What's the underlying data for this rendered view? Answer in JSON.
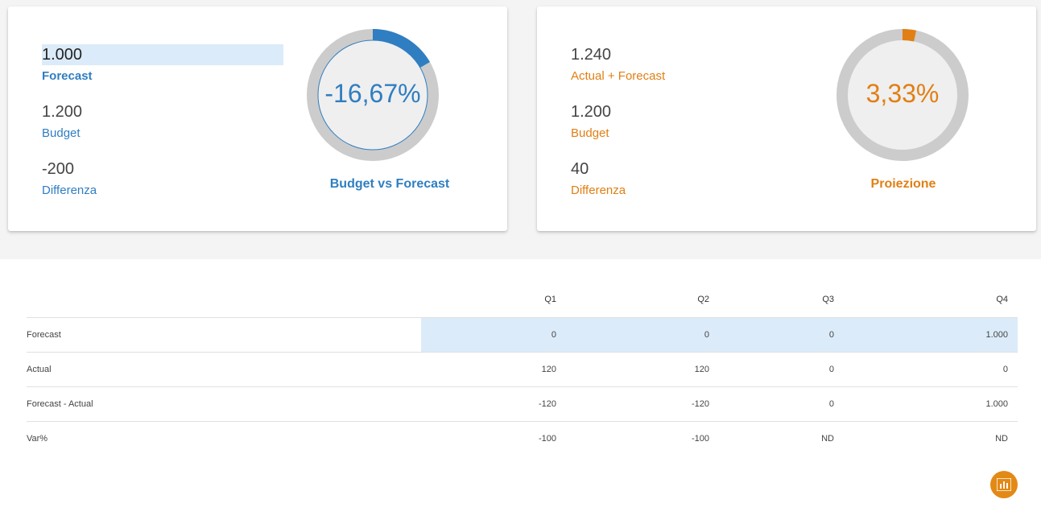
{
  "left_card": {
    "forecast_value": "1.000",
    "forecast_label": "Forecast",
    "budget_value": "1.200",
    "budget_label": "Budget",
    "diff_value": "-200",
    "diff_label": "Differenza",
    "gauge_value": "-16,67%",
    "gauge_fraction": 0.1667,
    "gauge_caption": "Budget vs Forecast",
    "accent_color": "#2f7ec1"
  },
  "right_card": {
    "actual_forecast_value": "1.240",
    "actual_forecast_label": "Actual + Forecast",
    "budget_value": "1.200",
    "budget_label": "Budget",
    "diff_value": "40",
    "diff_label": "Differenza",
    "gauge_value": "3,33%",
    "gauge_fraction": 0.0333,
    "gauge_caption": "Proiezione",
    "accent_color": "#e17f14"
  },
  "table": {
    "headers": [
      "",
      "Q1",
      "Q2",
      "Q3",
      "Q4"
    ],
    "rows": [
      {
        "label": "Forecast",
        "values": [
          "0",
          "0",
          "0",
          "1.000"
        ]
      },
      {
        "label": "Actual",
        "values": [
          "120",
          "120",
          "0",
          "0"
        ]
      },
      {
        "label": "Forecast - Actual",
        "values": [
          "-120",
          "-120",
          "0",
          "1.000"
        ]
      },
      {
        "label": "Var%",
        "values": [
          "-100",
          "-100",
          "ND",
          "ND"
        ]
      }
    ]
  },
  "chart_button": {
    "icon": "bar-chart-icon",
    "color": "#e38915"
  }
}
